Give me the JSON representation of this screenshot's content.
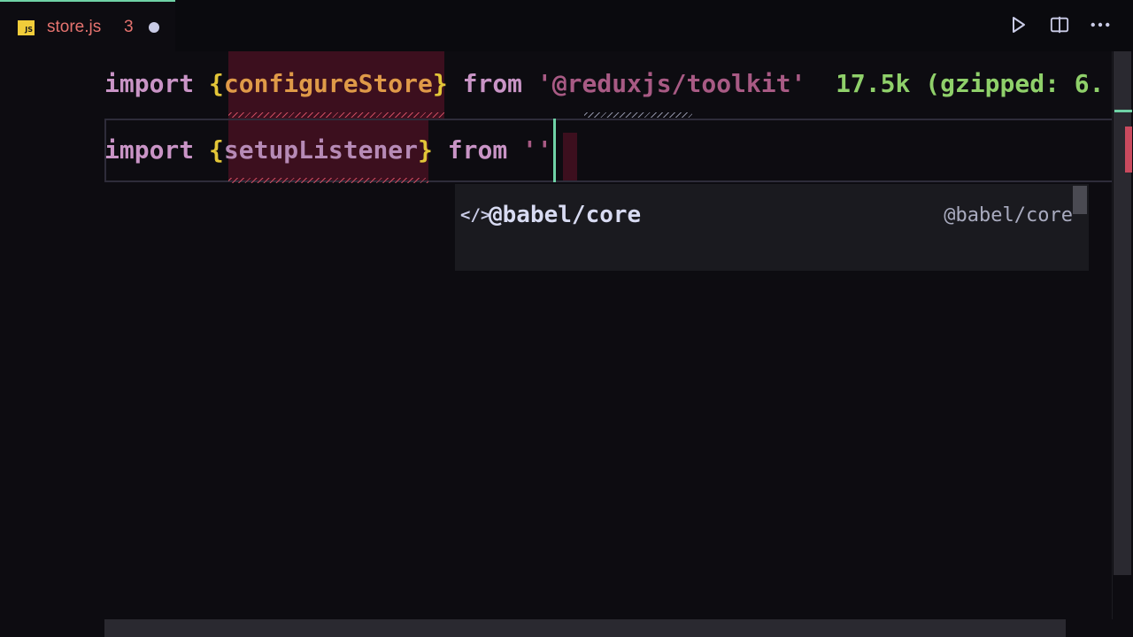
{
  "tab": {
    "badge": "JS",
    "filename": "store.js",
    "problem_count": "3",
    "modified_indicator": "●"
  },
  "actions": {
    "run": "run-icon",
    "split": "split-editor-icon",
    "more": "more-icon"
  },
  "code": {
    "line1": {
      "kw_import": "import",
      "open_brace": "{",
      "ident": "configureStore",
      "close_brace": "}",
      "kw_from": "from",
      "module": "'@reduxjs/toolkit'",
      "size": "17.5k (gzipped: 6."
    },
    "line2": {
      "kw_import": "import",
      "open_brace": "{",
      "ident": "setupListener",
      "close_brace": "}",
      "kw_from": "from",
      "quote_open": "'",
      "quote_close": "'"
    }
  },
  "suggest": {
    "icon": "</>",
    "label": "@babel/core",
    "detail": "@babel/core"
  },
  "colors": {
    "accent": "#6fd2a6",
    "error": "#c94a5e",
    "keyword": "#c994c6",
    "brace": "#e3c638",
    "size_label": "#8fd06a"
  }
}
